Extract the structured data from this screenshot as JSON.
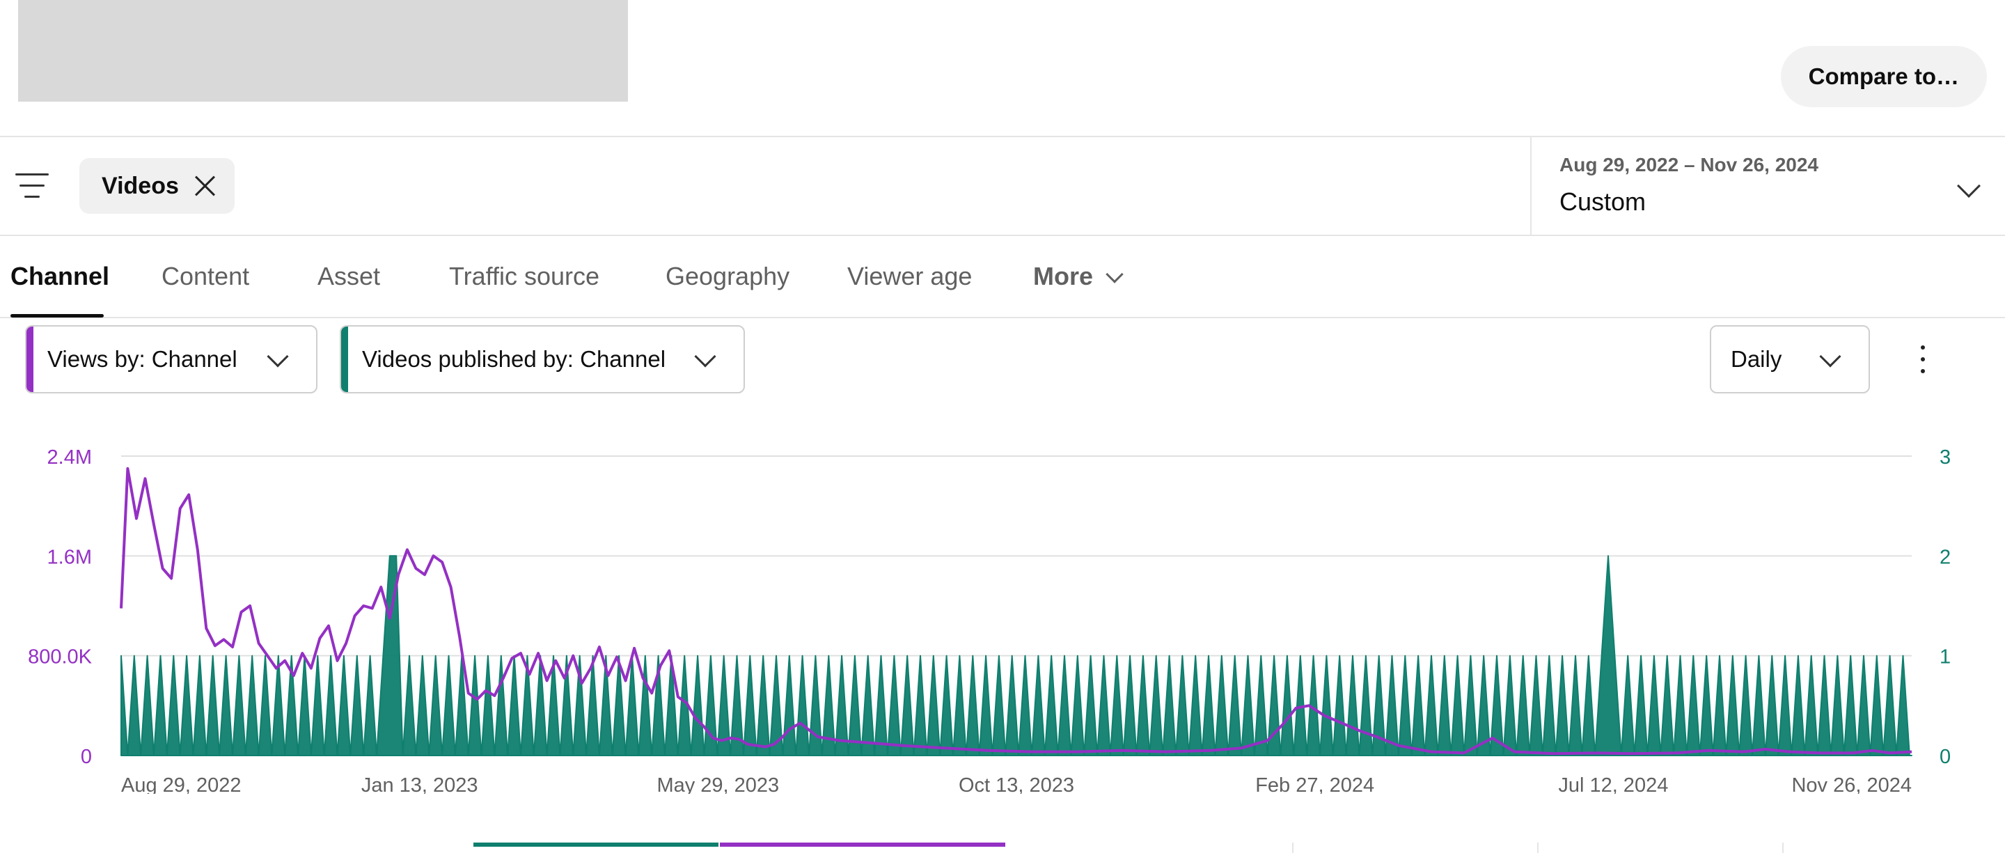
{
  "header": {
    "compare_label": "Compare to…"
  },
  "filter": {
    "chip_label": "Videos",
    "date_range": "Aug 29, 2022 – Nov 26, 2024",
    "period_label": "Custom"
  },
  "tabs": [
    {
      "label": "Channel",
      "active": true
    },
    {
      "label": "Content",
      "active": false
    },
    {
      "label": "Asset",
      "active": false
    },
    {
      "label": "Traffic source",
      "active": false
    },
    {
      "label": "Geography",
      "active": false
    },
    {
      "label": "Viewer age",
      "active": false
    },
    {
      "label": "More",
      "active": false
    }
  ],
  "selectors": {
    "primary": "Views by: Channel",
    "secondary": "Videos published by: Channel",
    "granularity": "Daily"
  },
  "colors": {
    "views": "#9430c4",
    "published": "#0f7f6e",
    "grid": "#e0e0e0",
    "axis_text": "#606060"
  },
  "chart_data": {
    "type": "line",
    "x_ticks": [
      "Aug 29, 2022",
      "Jan 13, 2023",
      "May 29, 2023",
      "Oct 13, 2023",
      "Feb 27, 2024",
      "Jul 12, 2024",
      "Nov 26, 2024"
    ],
    "x_range": [
      "2022-08-29",
      "2024-11-26"
    ],
    "y_left": {
      "ticks": [
        "0",
        "800.0K",
        "1.6M",
        "2.4M"
      ],
      "range": [
        0,
        2400000
      ]
    },
    "y_right": {
      "ticks": [
        "0",
        "1",
        "2",
        "3"
      ],
      "range": [
        0,
        3
      ]
    },
    "grid": true,
    "series": [
      {
        "axis": "left",
        "points": [
          [
            "2022-08-29",
            1180000
          ],
          [
            "2022-09-01",
            2300000
          ],
          [
            "2022-09-05",
            1900000
          ],
          [
            "2022-09-09",
            2220000
          ],
          [
            "2022-09-13",
            1850000
          ],
          [
            "2022-09-17",
            1500000
          ],
          [
            "2022-09-21",
            1420000
          ],
          [
            "2022-09-25",
            1980000
          ],
          [
            "2022-09-29",
            2090000
          ],
          [
            "2022-10-03",
            1650000
          ],
          [
            "2022-10-07",
            1020000
          ],
          [
            "2022-10-11",
            880000
          ],
          [
            "2022-10-15",
            930000
          ],
          [
            "2022-10-19",
            870000
          ],
          [
            "2022-10-23",
            1150000
          ],
          [
            "2022-10-27",
            1200000
          ],
          [
            "2022-10-31",
            900000
          ],
          [
            "2022-11-04",
            800000
          ],
          [
            "2022-11-08",
            700000
          ],
          [
            "2022-11-12",
            760000
          ],
          [
            "2022-11-16",
            640000
          ],
          [
            "2022-11-20",
            820000
          ],
          [
            "2022-11-24",
            700000
          ],
          [
            "2022-11-28",
            940000
          ],
          [
            "2022-12-02",
            1040000
          ],
          [
            "2022-12-06",
            760000
          ],
          [
            "2022-12-10",
            900000
          ],
          [
            "2022-12-14",
            1120000
          ],
          [
            "2022-12-18",
            1200000
          ],
          [
            "2022-12-22",
            1180000
          ],
          [
            "2022-12-26",
            1350000
          ],
          [
            "2022-12-30",
            1100000
          ],
          [
            "2023-01-03",
            1450000
          ],
          [
            "2023-01-07",
            1650000
          ],
          [
            "2023-01-11",
            1500000
          ],
          [
            "2023-01-15",
            1450000
          ],
          [
            "2023-01-19",
            1600000
          ],
          [
            "2023-01-23",
            1550000
          ],
          [
            "2023-01-27",
            1350000
          ],
          [
            "2023-01-31",
            950000
          ],
          [
            "2023-02-04",
            500000
          ],
          [
            "2023-02-08",
            450000
          ],
          [
            "2023-02-12",
            520000
          ],
          [
            "2023-02-16",
            480000
          ],
          [
            "2023-02-20",
            620000
          ],
          [
            "2023-02-24",
            780000
          ],
          [
            "2023-02-28",
            820000
          ],
          [
            "2023-03-04",
            650000
          ],
          [
            "2023-03-08",
            820000
          ],
          [
            "2023-03-12",
            600000
          ],
          [
            "2023-03-16",
            760000
          ],
          [
            "2023-03-20",
            620000
          ],
          [
            "2023-03-24",
            800000
          ],
          [
            "2023-03-28",
            580000
          ],
          [
            "2023-04-01",
            700000
          ],
          [
            "2023-04-05",
            870000
          ],
          [
            "2023-04-09",
            640000
          ],
          [
            "2023-04-13",
            790000
          ],
          [
            "2023-04-17",
            600000
          ],
          [
            "2023-04-21",
            860000
          ],
          [
            "2023-04-25",
            620000
          ],
          [
            "2023-04-29",
            500000
          ],
          [
            "2023-05-03",
            720000
          ],
          [
            "2023-05-07",
            840000
          ],
          [
            "2023-05-11",
            470000
          ],
          [
            "2023-05-15",
            420000
          ],
          [
            "2023-05-19",
            300000
          ],
          [
            "2023-05-23",
            230000
          ],
          [
            "2023-05-27",
            140000
          ],
          [
            "2023-05-31",
            120000
          ],
          [
            "2023-06-04",
            140000
          ],
          [
            "2023-06-08",
            130000
          ],
          [
            "2023-06-12",
            90000
          ],
          [
            "2023-06-16",
            80000
          ],
          [
            "2023-06-20",
            70000
          ],
          [
            "2023-06-24",
            90000
          ],
          [
            "2023-06-28",
            150000
          ],
          [
            "2023-07-01",
            210000
          ],
          [
            "2023-07-06",
            260000
          ],
          [
            "2023-07-14",
            150000
          ],
          [
            "2023-07-24",
            120000
          ],
          [
            "2023-08-08",
            100000
          ],
          [
            "2023-08-22",
            80000
          ],
          [
            "2023-09-10",
            60000
          ],
          [
            "2023-09-30",
            40000
          ],
          [
            "2023-10-20",
            30000
          ],
          [
            "2023-11-10",
            30000
          ],
          [
            "2023-12-01",
            40000
          ],
          [
            "2023-12-20",
            30000
          ],
          [
            "2024-01-10",
            40000
          ],
          [
            "2024-01-24",
            60000
          ],
          [
            "2024-02-05",
            120000
          ],
          [
            "2024-02-12",
            250000
          ],
          [
            "2024-02-18",
            380000
          ],
          [
            "2024-02-24",
            400000
          ],
          [
            "2024-03-02",
            320000
          ],
          [
            "2024-03-10",
            260000
          ],
          [
            "2024-03-18",
            200000
          ],
          [
            "2024-03-26",
            150000
          ],
          [
            "2024-04-05",
            80000
          ],
          [
            "2024-04-20",
            30000
          ],
          [
            "2024-05-05",
            20000
          ],
          [
            "2024-05-18",
            140000
          ],
          [
            "2024-05-28",
            30000
          ],
          [
            "2024-06-15",
            15000
          ],
          [
            "2024-07-05",
            20000
          ],
          [
            "2024-07-20",
            15000
          ],
          [
            "2024-08-10",
            20000
          ],
          [
            "2024-08-25",
            40000
          ],
          [
            "2024-09-10",
            30000
          ],
          [
            "2024-09-20",
            50000
          ],
          [
            "2024-10-01",
            30000
          ],
          [
            "2024-10-15",
            20000
          ],
          [
            "2024-10-30",
            20000
          ],
          [
            "2024-11-08",
            40000
          ],
          [
            "2024-11-16",
            20000
          ],
          [
            "2024-11-26",
            30000
          ]
        ]
      },
      {
        "axis": "right",
        "pattern": "alternating 0/1 daily counts",
        "base": 1,
        "spikes": [
          [
            "2022-12-31",
            2
          ],
          [
            "2023-01-02",
            2
          ],
          [
            "2024-07-11",
            2
          ]
        ]
      }
    ]
  }
}
